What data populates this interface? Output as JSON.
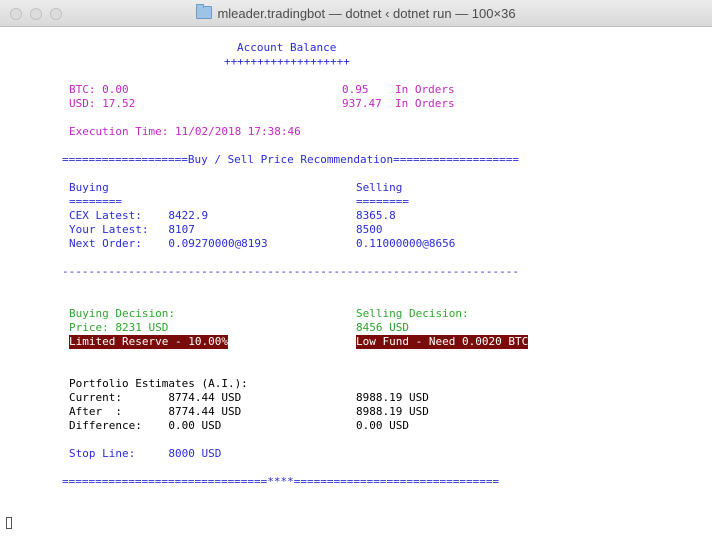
{
  "window": {
    "title": "mleader.tradingbot — dotnet ‹ dotnet run — 100×36"
  },
  "balance": {
    "title": "Account Balance",
    "underline": "+++++++++++++++++++",
    "btc": "BTC: 0.00",
    "btc_orders": "0.95    In Orders",
    "usd": "USD: 17.52",
    "usd_orders": "937.47  In Orders",
    "execution": "Execution Time: 11/02/2018 17:38:46"
  },
  "recommendation": {
    "header": "===================Buy / Sell Price Recommendation===================",
    "buying": {
      "label": "Buying",
      "underline": "========",
      "cex": "CEX Latest:    8422.9",
      "yours": "Your Latest:   8107",
      "next": "Next Order:    0.09270000@8193"
    },
    "selling": {
      "label": "Selling",
      "underline": "========",
      "cex": "8365.8",
      "yours": "8500",
      "next": "0.11000000@8656"
    },
    "divider": "---------------------------------------------------------------------"
  },
  "decision": {
    "buying_label": "Buying Decision:",
    "buying_price": "Price: 8231 USD",
    "buying_alert": "Limited Reserve - 10.00%",
    "selling_label": "Selling Decision:",
    "selling_price": "8456 USD",
    "selling_alert": "Low Fund - Need 0.0020 BTC"
  },
  "portfolio": {
    "title": "Portfolio Estimates (A.I.):",
    "current": "Current:       8774.44 USD",
    "current_sell": "8988.19 USD",
    "after": "After  :       8774.44 USD",
    "after_sell": "8988.19 USD",
    "difference": "Difference:    0.00 USD",
    "difference_sell": "0.00 USD",
    "stop_line": "Stop Line:     8000 USD",
    "footer": "===============================****==============================="
  }
}
